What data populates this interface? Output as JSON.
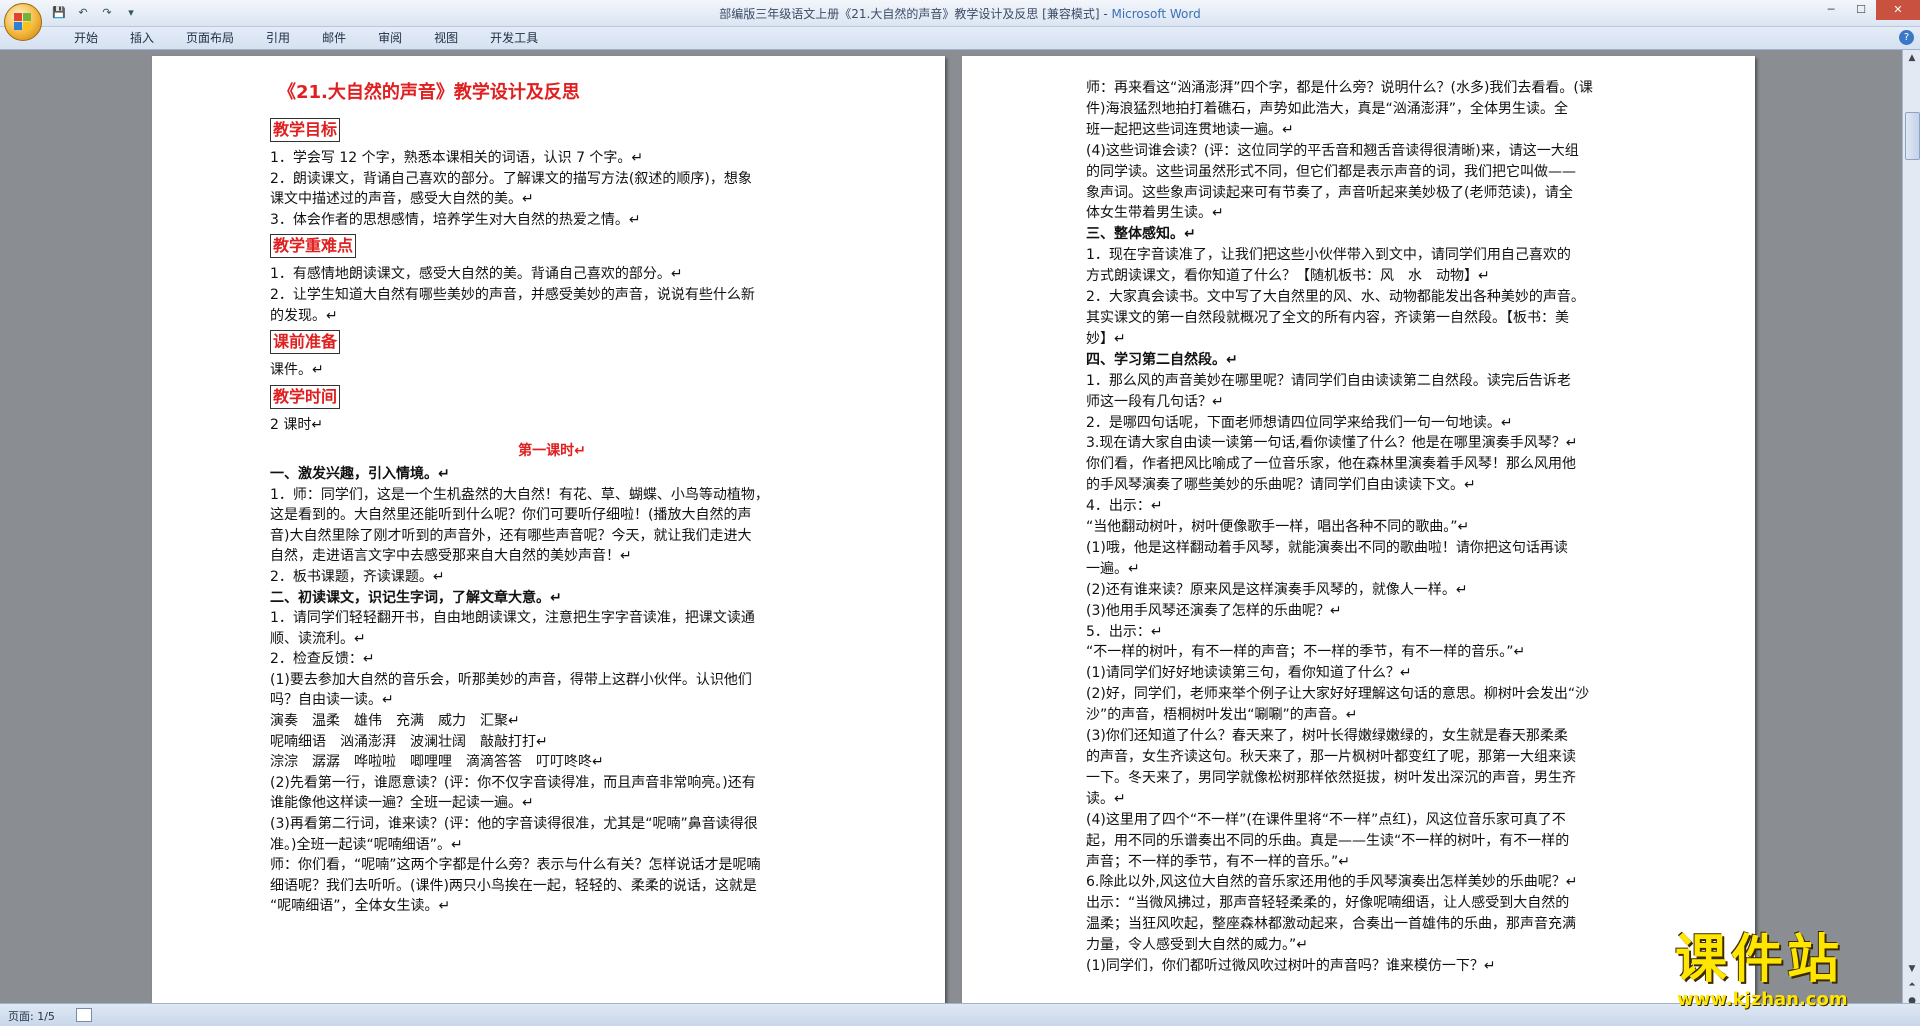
{
  "window": {
    "title": "部编版三年级语文上册《21.大自然的声音》教学设计及反思 [兼容模式] - ",
    "app_name": "Microsoft Word",
    "qat_more": "▾"
  },
  "ribbon": {
    "tabs": [
      "开始",
      "插入",
      "页面布局",
      "引用",
      "邮件",
      "审阅",
      "视图",
      "开发工具"
    ],
    "help": "?"
  },
  "status": {
    "page": "页面: 1/5"
  },
  "watermark": {
    "text": "课件站",
    "url": "www.kjzhan.com"
  },
  "page1": [
    {
      "t": "title",
      "text": "《21.大自然的声音》教学设计及反思"
    },
    {
      "t": "section",
      "text": "教学目标"
    },
    {
      "t": "p",
      "text": "1．学会写 12 个字，熟悉本课相关的词语，认识 7 个字。↵"
    },
    {
      "t": "p",
      "text": "2．朗读课文，背诵自己喜欢的部分。了解课文的描写方法(叙述的顺序)，想象"
    },
    {
      "t": "p",
      "text": "课文中描述过的声音，感受大自然的美。↵"
    },
    {
      "t": "p",
      "text": "3．体会作者的思想感情，培养学生对大自然的热爱之情。↵"
    },
    {
      "t": "section",
      "text": "教学重难点"
    },
    {
      "t": "p",
      "text": "1．有感情地朗读课文，感受大自然的美。背诵自己喜欢的部分。↵"
    },
    {
      "t": "p",
      "text": "2．让学生知道大自然有哪些美妙的声音，并感受美妙的声音，说说有些什么新"
    },
    {
      "t": "p",
      "text": "的发现。↵"
    },
    {
      "t": "section",
      "text": "课前准备"
    },
    {
      "t": "p",
      "text": "课件。↵"
    },
    {
      "t": "section",
      "text": "教学时间"
    },
    {
      "t": "p",
      "text": "2 课时↵"
    },
    {
      "t": "center",
      "text": "第一课时↵"
    },
    {
      "t": "b",
      "text": "一、激发兴趣，引入情境。↵"
    },
    {
      "t": "p",
      "text": "1．师：同学们，这是一个生机盎然的大自然！有花、草、蝴蝶、小鸟等动植物，"
    },
    {
      "t": "p",
      "text": "这是看到的。大自然里还能听到什么呢？你们可要听仔细啦！(播放大自然的声"
    },
    {
      "t": "p",
      "text": "音)大自然里除了刚才听到的声音外，还有哪些声音呢？今天，就让我们走进大"
    },
    {
      "t": "p",
      "text": "自然，走进语言文字中去感受那来自大自然的美妙声音！↵"
    },
    {
      "t": "p",
      "text": "2．板书课题，齐读课题。↵"
    },
    {
      "t": "b",
      "text": "二、初读课文，识记生字词，了解文章大意。↵"
    },
    {
      "t": "p",
      "text": "1．请同学们轻轻翻开书，自由地朗读课文，注意把生字字音读准，把课文读通"
    },
    {
      "t": "p",
      "text": "顺、读流利。↵"
    },
    {
      "t": "p",
      "text": "2．检查反馈：↵"
    },
    {
      "t": "p",
      "text": "(1)要去参加大自然的音乐会，听那美妙的声音，得带上这群小伙伴。认识他们"
    },
    {
      "t": "p",
      "text": "吗？自由读一读。↵"
    },
    {
      "t": "p",
      "text": "演奏　温柔　雄伟　充满　威力　汇聚↵"
    },
    {
      "t": "p",
      "text": "呢喃细语　汹涌澎湃　波澜壮阔　敲敲打打↵"
    },
    {
      "t": "p",
      "text": "淙淙　潺潺　哗啦啦　唧哩哩　滴滴答答　叮叮咚咚↵"
    },
    {
      "t": "p",
      "text": "(2)先看第一行，谁愿意读？(评：你不仅字音读得准，而且声音非常响亮。)还有"
    },
    {
      "t": "p",
      "text": "谁能像他这样读一遍？全班一起读一遍。↵"
    },
    {
      "t": "p",
      "text": "(3)再看第二行词，谁来读？(评：他的字音读得很准，尤其是“呢喃”鼻音读得很"
    },
    {
      "t": "p",
      "text": "准。)全班一起读“呢喃细语”。↵"
    },
    {
      "t": "p",
      "text": "师：你们看，“呢喃”这两个字都是什么旁？表示与什么有关？怎样说话才是呢喃"
    },
    {
      "t": "p",
      "text": "细语呢？我们去听听。(课件)两只小鸟挨在一起，轻轻的、柔柔的说话，这就是"
    },
    {
      "t": "p",
      "text": "“呢喃细语”，全体女生读。↵"
    }
  ],
  "page2": [
    {
      "t": "p",
      "text": "师：再来看这“汹涌澎湃”四个字，都是什么旁？说明什么？(水多)我们去看看。(课"
    },
    {
      "t": "p",
      "text": "件)海浪猛烈地拍打着礁石，声势如此浩大，真是“汹涌澎湃”，全体男生读。全"
    },
    {
      "t": "p",
      "text": "班一起把这些词连贯地读一遍。↵"
    },
    {
      "t": "p",
      "text": "(4)这些词谁会读？(评：这位同学的平舌音和翘舌音读得很清晰)来，请这一大组"
    },
    {
      "t": "p",
      "text": "的同学读。这些词虽然形式不同，但它们都是表示声音的词，我们把它叫做——"
    },
    {
      "t": "p",
      "text": "象声词。这些象声词读起来可有节奏了，声音听起来美妙极了(老师范读)，请全"
    },
    {
      "t": "p",
      "text": "体女生带着男生读。↵"
    },
    {
      "t": "b",
      "text": "三、整体感知。↵"
    },
    {
      "t": "p",
      "text": "1．现在字音读准了，让我们把这些小伙伴带入到文中，请同学们用自己喜欢的"
    },
    {
      "t": "p",
      "text": "方式朗读课文，看你知道了什么？【随机板书：风　水　动物】↵"
    },
    {
      "t": "p",
      "text": "2．大家真会读书。文中写了大自然里的风、水、动物都能发出各种美妙的声音。"
    },
    {
      "t": "p",
      "text": "其实课文的第一自然段就概况了全文的所有内容，齐读第一自然段。【板书：美"
    },
    {
      "t": "p",
      "text": "妙】↵"
    },
    {
      "t": "b",
      "text": "四、学习第二自然段。↵"
    },
    {
      "t": "p",
      "text": "1．那么风的声音美妙在哪里呢？请同学们自由读读第二自然段。读完后告诉老"
    },
    {
      "t": "p",
      "text": "师这一段有几句话？↵"
    },
    {
      "t": "p",
      "text": "2．是哪四句话呢，下面老师想请四位同学来给我们一句一句地读。↵"
    },
    {
      "t": "p",
      "text": "3.现在请大家自由读一读第一句话,看你读懂了什么？他是在哪里演奏手风琴？↵"
    },
    {
      "t": "p",
      "text": "你们看，作者把风比喻成了一位音乐家，他在森林里演奏着手风琴！那么风用他"
    },
    {
      "t": "p",
      "text": "的手风琴演奏了哪些美妙的乐曲呢？请同学们自由读读下文。↵"
    },
    {
      "t": "p",
      "text": "4．出示：↵"
    },
    {
      "t": "p",
      "text": "“当他翻动树叶，树叶便像歌手一样，唱出各种不同的歌曲。”↵"
    },
    {
      "t": "p",
      "text": "(1)哦，他是这样翻动着手风琴，就能演奏出不同的歌曲啦！请你把这句话再读"
    },
    {
      "t": "p",
      "text": "一遍。↵"
    },
    {
      "t": "p",
      "text": "(2)还有谁来读？原来风是这样演奏手风琴的，就像人一样。↵"
    },
    {
      "t": "p",
      "text": "(3)他用手风琴还演奏了怎样的乐曲呢？↵"
    },
    {
      "t": "p",
      "text": "5．出示：↵"
    },
    {
      "t": "p",
      "text": "“不一样的树叶，有不一样的声音；不一样的季节，有不一样的音乐。”↵"
    },
    {
      "t": "p",
      "text": "(1)请同学们好好地读读第三句，看你知道了什么？↵"
    },
    {
      "t": "p",
      "text": "(2)好，同学们，老师来举个例子让大家好好理解这句话的意思。柳树叶会发出“沙"
    },
    {
      "t": "p",
      "text": "沙”的声音，梧桐树叶发出“唰唰”的声音。↵"
    },
    {
      "t": "p",
      "text": "(3)你们还知道了什么？春天来了，树叶长得嫩绿嫩绿的，女生就是春天那柔柔"
    },
    {
      "t": "p",
      "text": "的声音，女生齐读这句。秋天来了，那一片枫树叶都变红了呢，那第一大组来读"
    },
    {
      "t": "p",
      "text": "一下。冬天来了，男同学就像松树那样依然挺拔，树叶发出深沉的声音，男生齐"
    },
    {
      "t": "p",
      "text": "读。↵"
    },
    {
      "t": "p",
      "text": "(4)这里用了四个“不一样”(在课件里将“不一样”点红)，风这位音乐家可真了不"
    },
    {
      "t": "p",
      "text": "起，用不同的乐谱奏出不同的乐曲。真是——生读“不一样的树叶，有不一样的"
    },
    {
      "t": "p",
      "text": "声音；不一样的季节，有不一样的音乐。”↵"
    },
    {
      "t": "p",
      "text": "6.除此以外,风这位大自然的音乐家还用他的手风琴演奏出怎样美妙的乐曲呢？↵"
    },
    {
      "t": "p",
      "text": "出示：“当微风拂过，那声音轻轻柔柔的，好像呢喃细语，让人感受到大自然的"
    },
    {
      "t": "p",
      "text": "温柔；当狂风吹起，整座森林都激动起来，合奏出一首雄伟的乐曲，那声音充满"
    },
    {
      "t": "p",
      "text": "力量，令人感受到大自然的威力。”↵"
    },
    {
      "t": "p",
      "text": "(1)同学们，你们都听过微风吹过树叶的声音吗？谁来模仿一下？↵"
    }
  ]
}
